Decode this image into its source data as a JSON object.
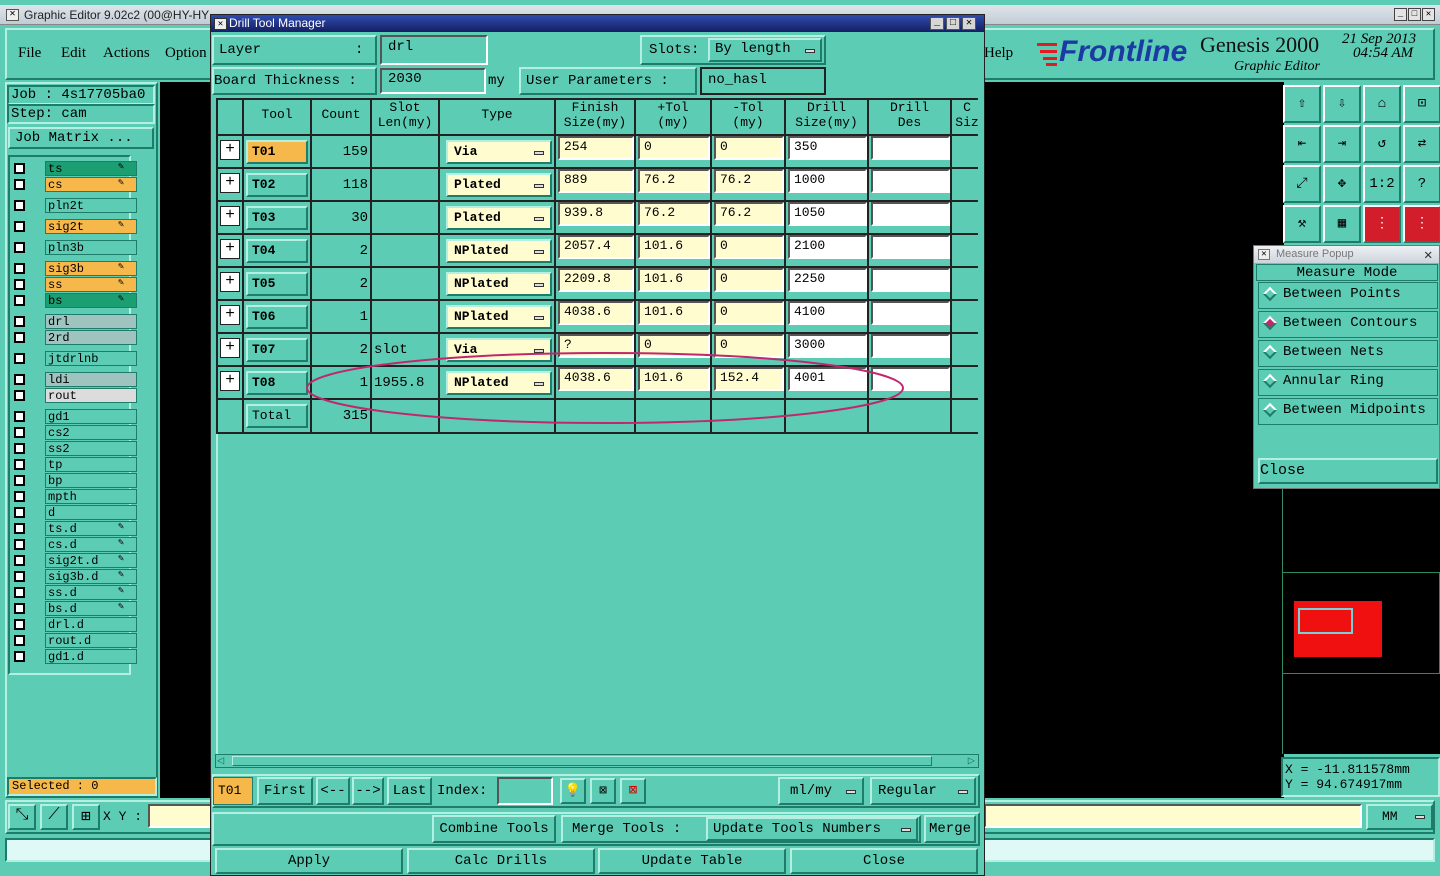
{
  "main_window": {
    "title": "Graphic Editor 9.02c2 (00@HY-HY",
    "menu": [
      "File",
      "Edit",
      "Actions",
      "Option"
    ],
    "help": "Help"
  },
  "brand": {
    "logo": "Frontline",
    "product": "Genesis 2000",
    "subtitle": "Graphic Editor",
    "date": "21 Sep 2013",
    "time": "04:54 AM"
  },
  "left_panel": {
    "job": "Job : 4s17705ba0",
    "step": "Step: cam",
    "job_matrix": "Job Matrix ...",
    "layers": [
      {
        "name": "ts",
        "color": "#1a9e72",
        "edit": true
      },
      {
        "name": "cs",
        "color": "#f6b84a",
        "edit": true
      },
      {
        "name": "pln2t",
        "color": "#5ccdb4",
        "edit": false
      },
      {
        "name": "sig2t",
        "color": "#f6b84a",
        "edit": true
      },
      {
        "name": "pln3b",
        "color": "#5ccdb4",
        "edit": false
      },
      {
        "name": "sig3b",
        "color": "#f6b84a",
        "edit": true
      },
      {
        "name": "ss",
        "color": "#f6b84a",
        "edit": true
      },
      {
        "name": "bs",
        "color": "#1a9e72",
        "edit": true
      },
      {
        "name": "drl",
        "color": "#9fc4c0",
        "edit": false
      },
      {
        "name": "2rd",
        "color": "#9fc4c0",
        "edit": false
      },
      {
        "name": "jtdrlnb",
        "color": "#5ccdb4",
        "edit": false
      },
      {
        "name": "ldi",
        "color": "#9fc4c0",
        "edit": false
      },
      {
        "name": "rout",
        "color": "#dcdcdc",
        "edit": false
      },
      {
        "name": "gd1",
        "color": "#5ccdb4",
        "edit": false
      },
      {
        "name": "cs2",
        "color": "#5ccdb4",
        "edit": false
      },
      {
        "name": "ss2",
        "color": "#5ccdb4",
        "edit": false
      },
      {
        "name": "tp",
        "color": "#5ccdb4",
        "edit": false
      },
      {
        "name": "bp",
        "color": "#5ccdb4",
        "edit": false
      },
      {
        "name": "mpth",
        "color": "#5ccdb4",
        "edit": false
      },
      {
        "name": "d",
        "color": "#5ccdb4",
        "edit": false
      },
      {
        "name": "ts.d",
        "color": "#5ccdb4",
        "edit": true
      },
      {
        "name": "cs.d",
        "color": "#5ccdb4",
        "edit": true
      },
      {
        "name": "sig2t.d",
        "color": "#5ccdb4",
        "edit": true
      },
      {
        "name": "sig3b.d",
        "color": "#5ccdb4",
        "edit": true
      },
      {
        "name": "ss.d",
        "color": "#5ccdb4",
        "edit": true
      },
      {
        "name": "bs.d",
        "color": "#5ccdb4",
        "edit": true
      },
      {
        "name": "drl.d",
        "color": "#5ccdb4",
        "edit": false
      },
      {
        "name": "rout.d",
        "color": "#5ccdb4",
        "edit": false
      },
      {
        "name": "gd1.d",
        "color": "#5ccdb4",
        "edit": false
      }
    ],
    "selected": "Selected : 0",
    "xy_label": "X Y :"
  },
  "units": "MM",
  "coords": {
    "x": "X = -11.811578mm",
    "y": "Y = 94.674917mm"
  },
  "measure": {
    "title": "Measure Popup",
    "mode_label": "Measure Mode",
    "modes": [
      "Between Points",
      "Between Contours",
      "Between Nets",
      "Annular Ring",
      "Between Midpoints"
    ],
    "selected_mode": "Between Contours",
    "close": "Close"
  },
  "tool_icons": [
    "save-up",
    "save-down",
    "home",
    "frame",
    "prev-step",
    "next-step",
    "undo-snap",
    "swap",
    "zoom-fit",
    "zoom-center",
    "one-two",
    "help",
    "tools",
    "grid",
    "net-analyze",
    "net-compare"
  ],
  "dtm": {
    "title": "Drill Tool Manager",
    "layer_label": "Layer",
    "layer_colon": ":",
    "layer_value": "drl",
    "slots_label": "Slots:",
    "slots_value": "By length",
    "thickness_label": "Board Thickness :",
    "thickness_value": "2030",
    "thickness_unit": "my",
    "user_params_label": "User Parameters :",
    "user_params_value": "no_hasl",
    "headers": {
      "tool": "Tool",
      "count": "Count",
      "slot1": "Slot",
      "slot2": "Len(my)",
      "type": "Type",
      "finish1": "Finish",
      "finish2": "Size(my)",
      "ptol1": "+Tol",
      "ptol2": "(my)",
      "mtol1": "-Tol",
      "mtol2": "(my)",
      "drill1": "Drill",
      "drill2": "Size(my)",
      "des1": "Drill",
      "des2": "Des",
      "cut1": "C",
      "cut2": "Siz"
    },
    "rows": [
      {
        "tool": "T01",
        "count": "159",
        "slot": "",
        "type": "Via",
        "finish": "254",
        "ptol": "0",
        "mtol": "0",
        "drill": "350",
        "des": ""
      },
      {
        "tool": "T02",
        "count": "118",
        "slot": "",
        "type": "Plated",
        "finish": "889",
        "ptol": "76.2",
        "mtol": "76.2",
        "drill": "1000",
        "des": ""
      },
      {
        "tool": "T03",
        "count": "30",
        "slot": "",
        "type": "Plated",
        "finish": "939.8",
        "ptol": "76.2",
        "mtol": "76.2",
        "drill": "1050",
        "des": ""
      },
      {
        "tool": "T04",
        "count": "2",
        "slot": "",
        "type": "NPlated",
        "finish": "2057.4",
        "ptol": "101.6",
        "mtol": "0",
        "drill": "2100",
        "des": ""
      },
      {
        "tool": "T05",
        "count": "2",
        "slot": "",
        "type": "NPlated",
        "finish": "2209.8",
        "ptol": "101.6",
        "mtol": "0",
        "drill": "2250",
        "des": ""
      },
      {
        "tool": "T06",
        "count": "1",
        "slot": "",
        "type": "NPlated",
        "finish": "4038.6",
        "ptol": "101.6",
        "mtol": "0",
        "drill": "4100",
        "des": ""
      },
      {
        "tool": "T07",
        "count": "2",
        "slot": "slot",
        "type": "Via",
        "finish": "?",
        "ptol": "0",
        "mtol": "0",
        "drill": "3000",
        "des": ""
      },
      {
        "tool": "T08",
        "count": "1",
        "slot": "1955.8",
        "type": "NPlated",
        "finish": "4038.6",
        "ptol": "101.6",
        "mtol": "152.4",
        "drill": "4001",
        "des": ""
      }
    ],
    "total_label": "Total",
    "total_count": "315",
    "nav": {
      "current": "T01",
      "first": "First",
      "prev": "<--",
      "next": "-->",
      "last": "Last",
      "index_label": "Index:",
      "units": "ml/my",
      "mode": "Regular"
    },
    "combine": "Combine Tools",
    "merge_label": "Merge Tools :",
    "update_numbers": "Update Tools Numbers",
    "merge": "Merge",
    "apply": "Apply",
    "calc": "Calc Drills",
    "update_table": "Update Table",
    "close": "Close"
  }
}
